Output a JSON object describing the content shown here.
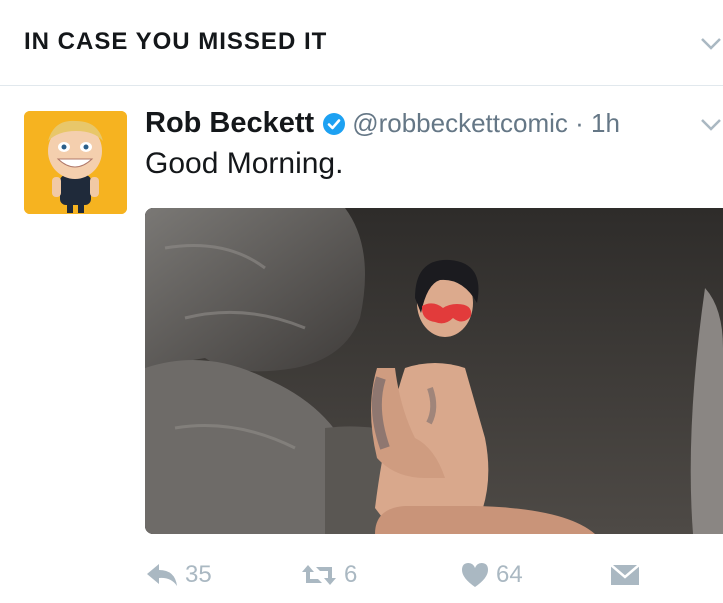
{
  "section": {
    "title": "IN CASE YOU MISSED IT",
    "menu_icon": "chevron-down-icon"
  },
  "tweet": {
    "author_name": "Rob Beckett",
    "verified": true,
    "handle": "@robbeckettcomic",
    "separator": " · ",
    "time": "1h",
    "text": "Good Morning.",
    "menu_icon": "chevron-down-icon",
    "media": {
      "description_icon": "photo"
    },
    "actions": {
      "reply": {
        "icon": "reply-icon",
        "count": "35"
      },
      "retweet": {
        "icon": "retweet-icon",
        "count": "6"
      },
      "like": {
        "icon": "heart-icon",
        "count": "64"
      },
      "dm": {
        "icon": "envelope-icon"
      }
    }
  },
  "colors": {
    "text": "#14171a",
    "secondary": "#657786",
    "action_gray": "#aab8c2",
    "verified_blue": "#1da1f2",
    "divider": "#e1e8ed"
  }
}
